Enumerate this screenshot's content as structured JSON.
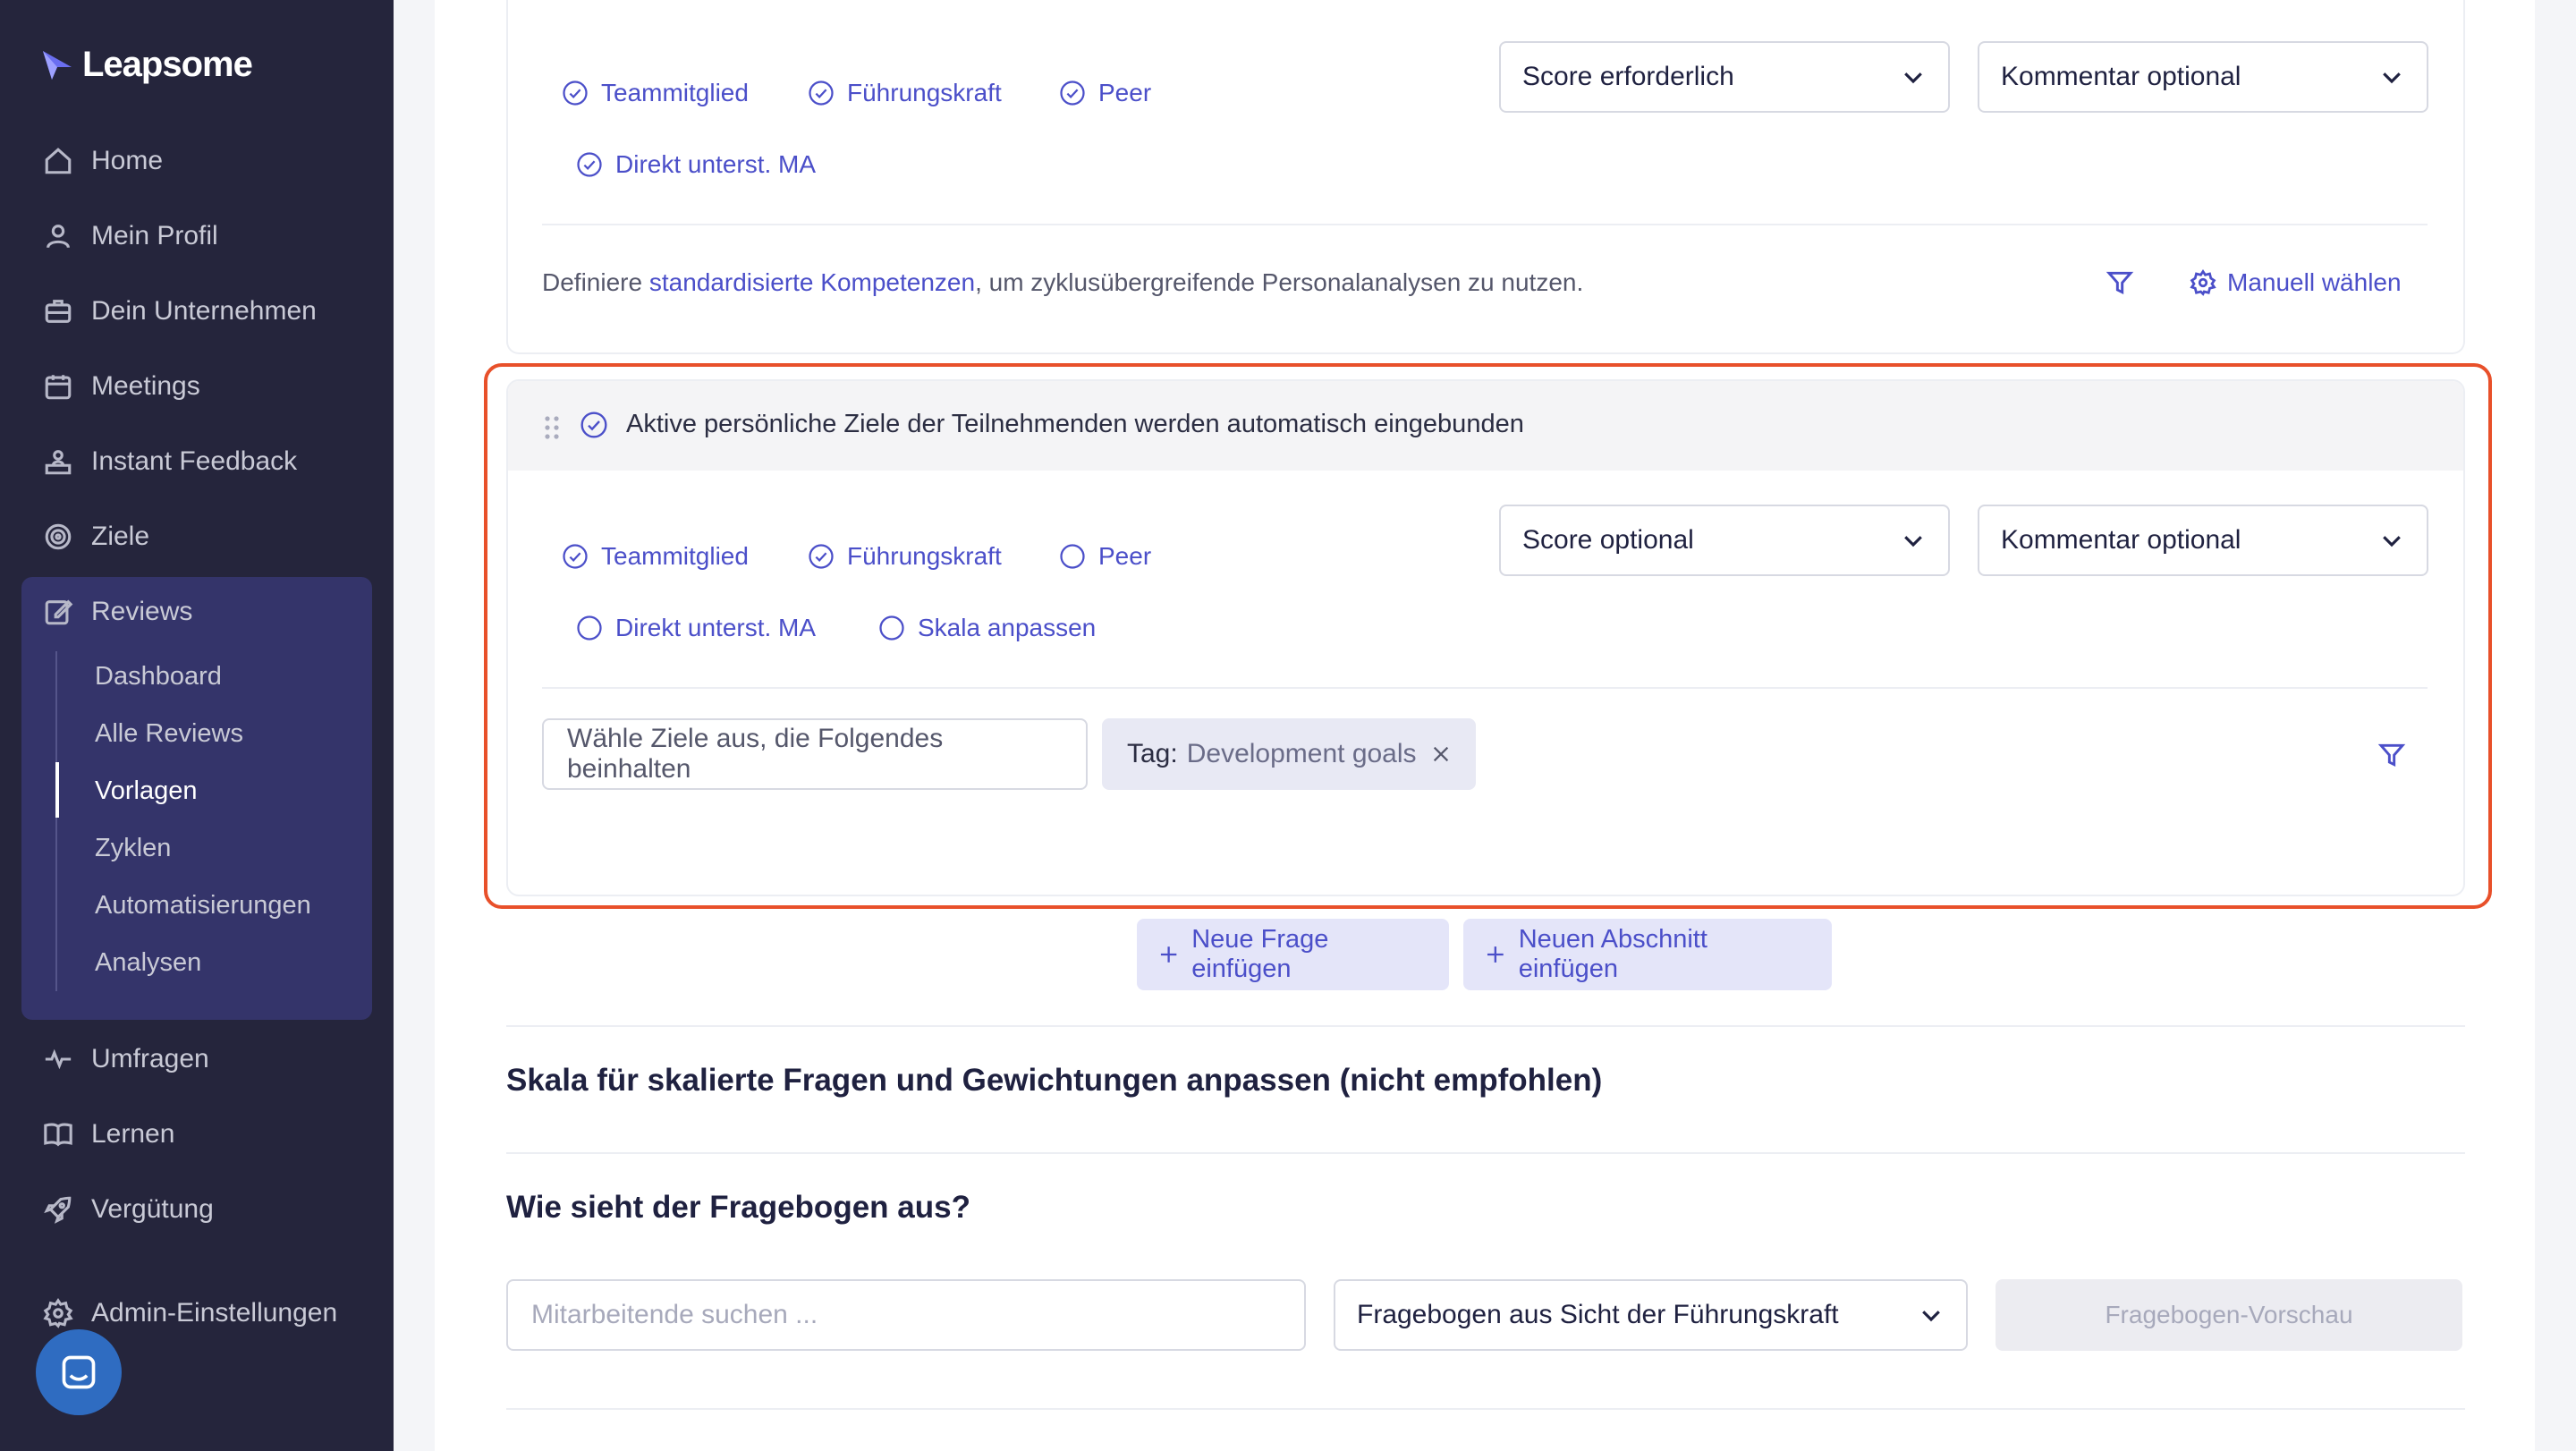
{
  "app": {
    "brand": "Leapsome"
  },
  "sidebar": {
    "items": [
      {
        "label": "Home",
        "icon": "home-icon"
      },
      {
        "label": "Mein Profil",
        "icon": "user-icon"
      },
      {
        "label": "Dein Unternehmen",
        "icon": "briefcase-icon"
      },
      {
        "label": "Meetings",
        "icon": "calendar-icon"
      },
      {
        "label": "Instant Feedback",
        "icon": "feedback-icon"
      },
      {
        "label": "Ziele",
        "icon": "target-icon"
      },
      {
        "label": "Reviews",
        "icon": "edit-icon"
      },
      {
        "label": "Umfragen",
        "icon": "pulse-icon"
      },
      {
        "label": "Lernen",
        "icon": "book-icon"
      },
      {
        "label": "Vergütung",
        "icon": "rocket-icon"
      },
      {
        "label": "Admin-Einstellungen",
        "icon": "gear-icon"
      }
    ],
    "reviews_sub": [
      "Dashboard",
      "Alle Reviews",
      "Vorlagen",
      "Zyklen",
      "Automatisierungen",
      "Analysen"
    ],
    "active_sub": "Vorlagen"
  },
  "competency_card": {
    "roles": [
      "Teammitglied",
      "Führungskraft",
      "Peer",
      "Direkt unterst. MA"
    ],
    "score_select": "Score erforderlich",
    "comment_select": "Kommentar optional",
    "info_prefix": "Definiere ",
    "info_link": "standardisierte Kompetenzen",
    "info_suffix": ", um zyklusübergreifende Personalanalysen zu nutzen.",
    "manual_label": "Manuell wählen"
  },
  "goals_card": {
    "header": "Aktive persönliche Ziele der Teilnehmenden werden automatisch eingebunden",
    "roles": [
      "Teammitglied",
      "Führungskraft",
      "Peer",
      "Direkt unterst. MA",
      "Skala anpassen"
    ],
    "roles_checked": [
      true,
      true,
      false,
      false,
      false
    ],
    "score_select": "Score optional",
    "comment_select": "Kommentar optional",
    "filter_input": "Wähle Ziele aus, die Folgendes beinhalten",
    "tag_key": "Tag:",
    "tag_value": "Development goals"
  },
  "actions": {
    "new_question": "Neue Frage einfügen",
    "new_section": "Neuen Abschnitt einfügen"
  },
  "scale_section": {
    "title": "Skala für skalierte Fragen und Gewichtungen anpassen (nicht empfohlen)"
  },
  "preview_section": {
    "title": "Wie sieht der Fragebogen aus?",
    "search_placeholder": "Mitarbeitende suchen ...",
    "perspective_select": "Fragebogen aus Sicht der Führungskraft",
    "preview_button": "Fragebogen-Vorschau"
  },
  "colors": {
    "accent": "#4b4fc9",
    "sidebar_bg": "#25253c",
    "highlight": "#e8502a"
  }
}
